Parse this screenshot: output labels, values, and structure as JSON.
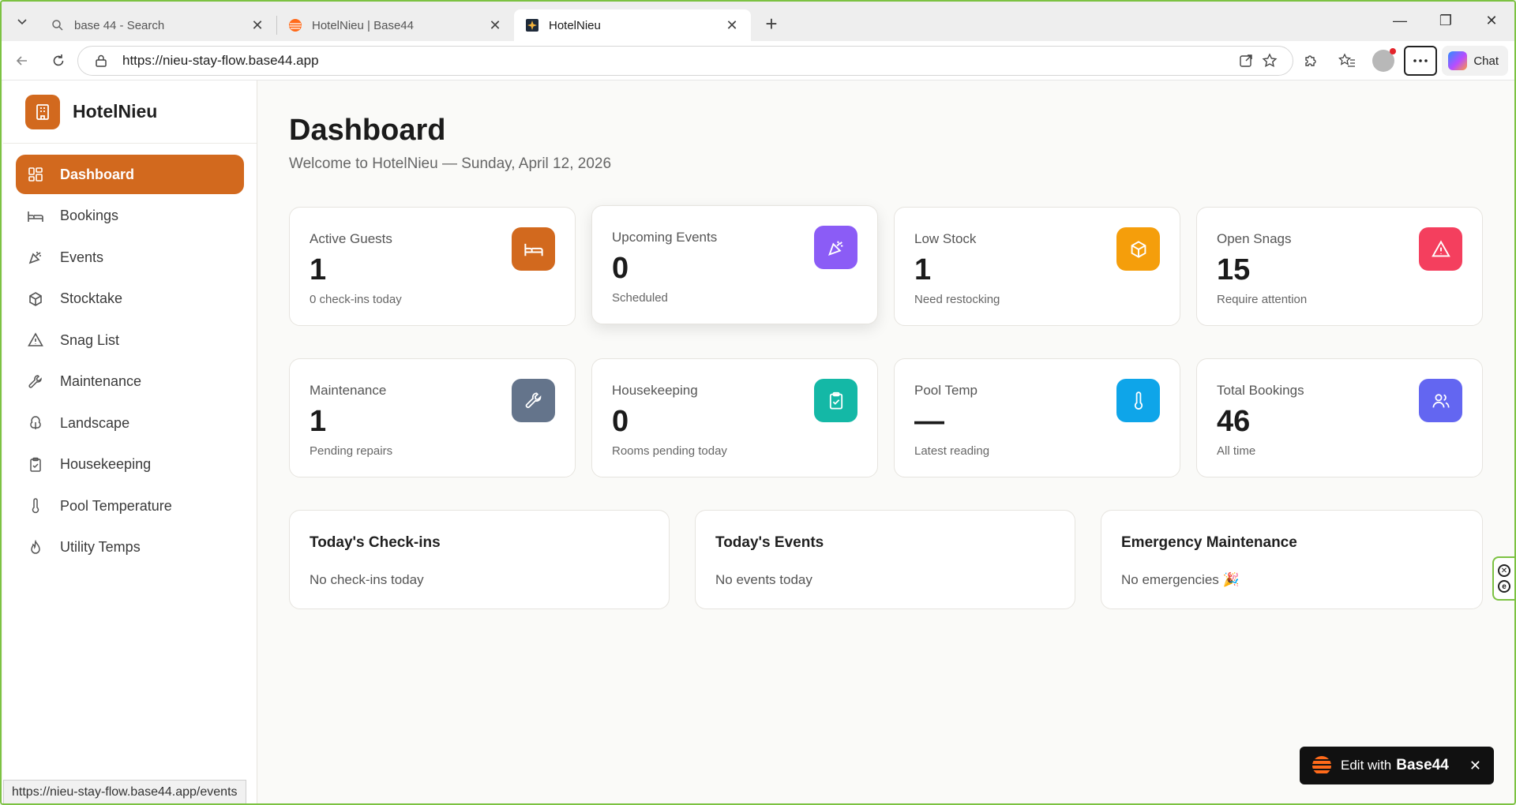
{
  "browser": {
    "tabs": [
      {
        "label": "base 44 - Search",
        "close": "✕"
      },
      {
        "label": "HotelNieu | Base44",
        "close": "✕"
      },
      {
        "label": "HotelNieu",
        "close": "✕"
      }
    ],
    "new_tab": "+",
    "url": "https://nieu-stay-flow.base44.app",
    "chat_label": "Chat",
    "status_url": "https://nieu-stay-flow.base44.app/events",
    "window_controls": {
      "minimize": "—",
      "restore": "❐",
      "close": "✕"
    }
  },
  "app": {
    "brand": "HotelNieu",
    "nav": [
      {
        "label": "Dashboard",
        "icon": "dashboard-icon",
        "active": true
      },
      {
        "label": "Bookings",
        "icon": "bed-icon"
      },
      {
        "label": "Events",
        "icon": "party-popper-icon"
      },
      {
        "label": "Stocktake",
        "icon": "package-icon"
      },
      {
        "label": "Snag List",
        "icon": "alert-triangle-icon"
      },
      {
        "label": "Maintenance",
        "icon": "wrench-icon"
      },
      {
        "label": "Landscape",
        "icon": "tree-icon"
      },
      {
        "label": "Housekeeping",
        "icon": "clipboard-check-icon"
      },
      {
        "label": "Pool Temperature",
        "icon": "thermometer-icon"
      },
      {
        "label": "Utility Temps",
        "icon": "flame-icon"
      }
    ]
  },
  "dashboard": {
    "title": "Dashboard",
    "subtitle": "Welcome to HotelNieu — Sunday, April 12, 2026",
    "stats": [
      {
        "title": "Active Guests",
        "value": "1",
        "note": "0 check-ins today",
        "icon": "bed-icon",
        "color": "#d2691e"
      },
      {
        "title": "Upcoming Events",
        "value": "0",
        "note": "Scheduled",
        "icon": "party-popper-icon",
        "color": "#8b5cf6"
      },
      {
        "title": "Low Stock",
        "value": "1",
        "note": "Need restocking",
        "icon": "package-icon",
        "color": "#f59e0b"
      },
      {
        "title": "Open Snags",
        "value": "15",
        "note": "Require attention",
        "icon": "alert-triangle-icon",
        "color": "#f43f5e"
      },
      {
        "title": "Maintenance",
        "value": "1",
        "note": "Pending repairs",
        "icon": "wrench-icon",
        "color": "#64748b"
      },
      {
        "title": "Housekeeping",
        "value": "0",
        "note": "Rooms pending today",
        "icon": "clipboard-check-icon",
        "color": "#14b8a6"
      },
      {
        "title": "Pool Temp",
        "value": "—",
        "note": "Latest reading",
        "icon": "thermometer-icon",
        "color": "#0ea5e9"
      },
      {
        "title": "Total Bookings",
        "value": "46",
        "note": "All time",
        "icon": "users-icon",
        "color": "#6366f1"
      }
    ],
    "panels": [
      {
        "title": "Today's Check-ins",
        "text": "No check-ins today"
      },
      {
        "title": "Today's Events",
        "text": "No events today"
      },
      {
        "title": "Emergency Maintenance",
        "text": "No emergencies 🎉"
      }
    ]
  },
  "edit_badge": {
    "text": "Edit with",
    "brand": "Base44",
    "close": "✕"
  }
}
